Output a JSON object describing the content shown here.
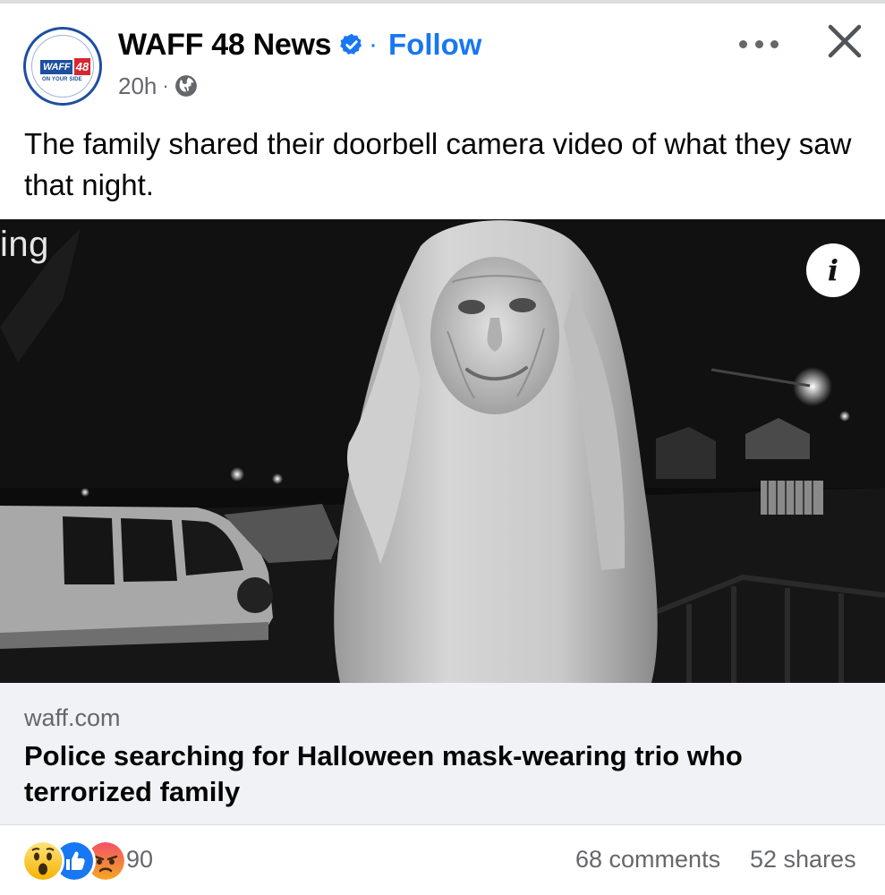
{
  "post": {
    "page_name": "WAFF 48 News",
    "separator": "·",
    "follow_label": "Follow",
    "time": "20h",
    "meta_separator": "·",
    "privacy_icon": "globe-icon",
    "caption": "The family shared their doorbell camera video of what they saw that night."
  },
  "avatar": {
    "logo_word": "WAFF",
    "logo_number": "48",
    "logo_tagline": "ON YOUR SIDE"
  },
  "media": {
    "watermark": "ing",
    "info_label": "i"
  },
  "link_preview": {
    "domain": "waff.com",
    "title": "Police searching for Halloween mask-wearing trio who terrorized family"
  },
  "footer": {
    "reactions": [
      "wow",
      "like",
      "angry"
    ],
    "reaction_count": "90",
    "comments": "68 comments",
    "shares": "52 shares"
  },
  "colors": {
    "accent": "#1877f2",
    "secondary_text": "#65676b",
    "link_card_bg": "#f0f2f5"
  }
}
